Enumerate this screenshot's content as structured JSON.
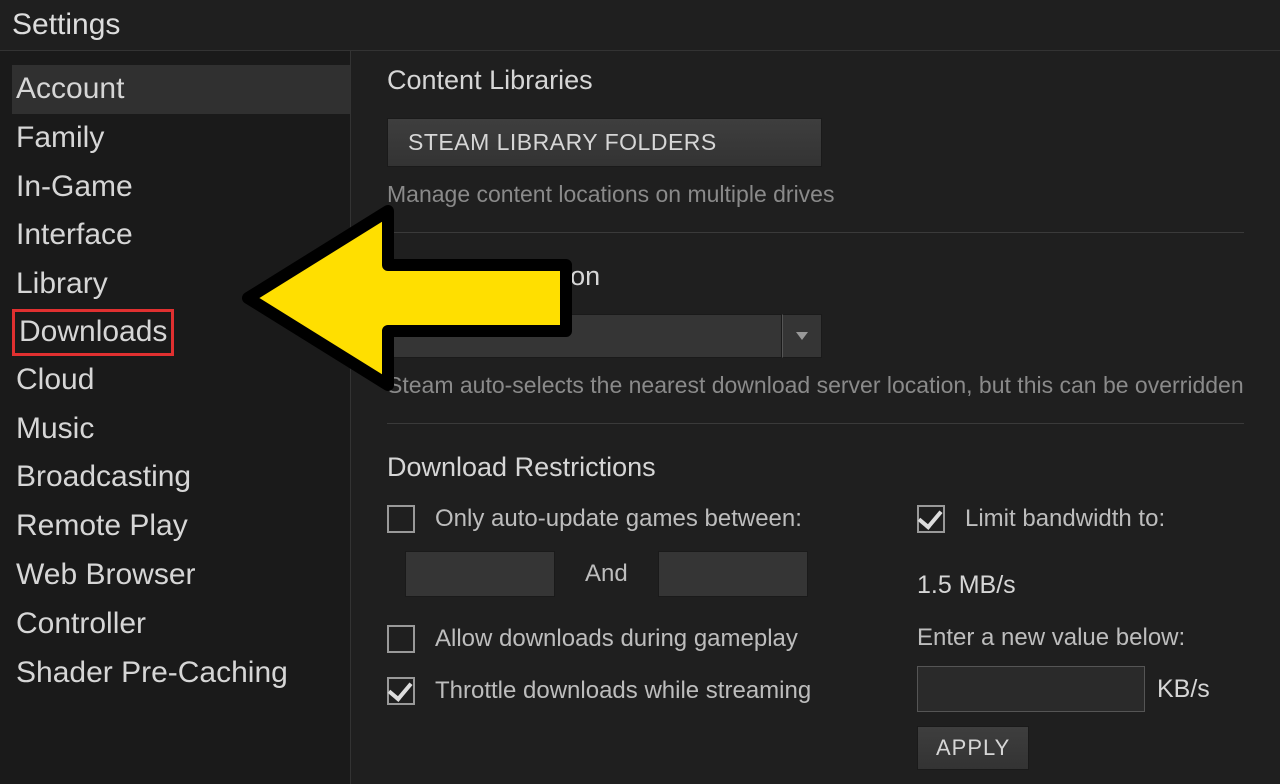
{
  "window": {
    "title": "Settings"
  },
  "sidebar": {
    "items": [
      {
        "label": "Account"
      },
      {
        "label": "Family"
      },
      {
        "label": "In-Game"
      },
      {
        "label": "Interface"
      },
      {
        "label": "Library"
      },
      {
        "label": "Downloads"
      },
      {
        "label": "Cloud"
      },
      {
        "label": "Music"
      },
      {
        "label": "Broadcasting"
      },
      {
        "label": "Remote Play"
      },
      {
        "label": "Web Browser"
      },
      {
        "label": "Controller"
      },
      {
        "label": "Shader Pre-Caching"
      }
    ],
    "active_index": 0,
    "highlighted_index": 5
  },
  "main": {
    "content_libraries": {
      "title": "Content Libraries",
      "button_label": "STEAM LIBRARY FOLDERS",
      "hint": "Manage content locations on multiple drives"
    },
    "download_region": {
      "title": "Download Region",
      "selected": "",
      "hint": "Steam auto-selects the nearest download server location, but this can be overridden"
    },
    "download_restrictions": {
      "title": "Download Restrictions",
      "auto_update": {
        "label": "Only auto-update games between:",
        "checked": false
      },
      "time_from": "",
      "time_and": "And",
      "time_to": "",
      "allow_gameplay": {
        "label": "Allow downloads during gameplay",
        "checked": false
      },
      "throttle_streaming": {
        "label": "Throttle downloads while streaming",
        "checked": true
      },
      "limit_bandwidth": {
        "label": "Limit bandwidth to:",
        "checked": true
      },
      "current_limit": "1.5 MB/s",
      "new_value_hint": "Enter a new value below:",
      "new_value": "",
      "unit": "KB/s",
      "apply_label": "APPLY"
    }
  }
}
